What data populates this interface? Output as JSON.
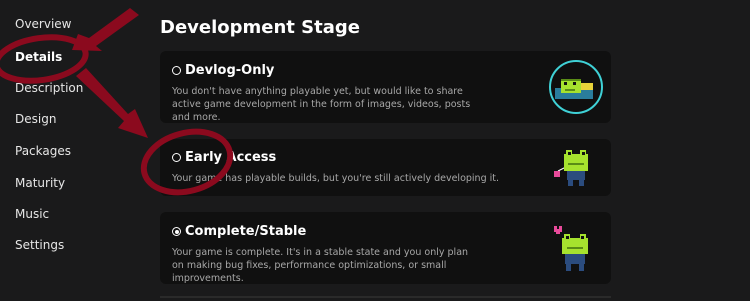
{
  "sidebar": {
    "items": [
      {
        "label": "Overview",
        "active": false
      },
      {
        "label": "Details",
        "active": true
      },
      {
        "label": "Description",
        "active": false
      },
      {
        "label": "Design",
        "active": false
      },
      {
        "label": "Packages",
        "active": false
      },
      {
        "label": "Maturity",
        "active": false
      },
      {
        "label": "Music",
        "active": false
      },
      {
        "label": "Settings",
        "active": false
      }
    ]
  },
  "main": {
    "title": "Development Stage",
    "options": [
      {
        "title": "Devlog-Only",
        "selected": false,
        "description": "You don't have anything playable yet, but would like to share active game development in the form of images, videos, posts and more.",
        "icon": "frog-in-bubble-icon"
      },
      {
        "title": "Early Access",
        "selected": false,
        "description": "Your game has playable builds, but you're still actively developing it.",
        "icon": "frog-with-balloon-icon"
      },
      {
        "title": "Complete/Stable",
        "selected": true,
        "description": "Your game is complete. It's in a stable state and you only plan on making bug fixes, performance optimizations, or small improvements.",
        "icon": "frog-with-heart-icon"
      }
    ]
  },
  "colors": {
    "background": "#1a1a1b",
    "card": "#101010",
    "annotation": "#8b0a1e",
    "frog_green": "#a6e22e"
  }
}
